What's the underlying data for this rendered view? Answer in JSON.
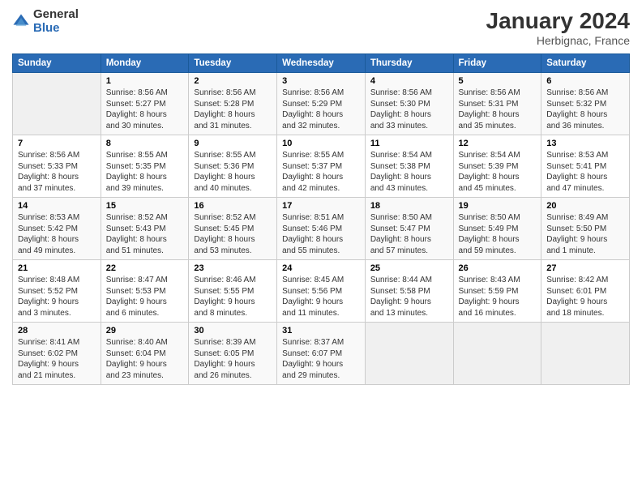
{
  "logo": {
    "general": "General",
    "blue": "Blue"
  },
  "header": {
    "title": "January 2024",
    "subtitle": "Herbignac, France"
  },
  "days_of_week": [
    "Sunday",
    "Monday",
    "Tuesday",
    "Wednesday",
    "Thursday",
    "Friday",
    "Saturday"
  ],
  "weeks": [
    [
      {
        "num": "",
        "info": ""
      },
      {
        "num": "1",
        "info": "Sunrise: 8:56 AM\nSunset: 5:27 PM\nDaylight: 8 hours\nand 30 minutes."
      },
      {
        "num": "2",
        "info": "Sunrise: 8:56 AM\nSunset: 5:28 PM\nDaylight: 8 hours\nand 31 minutes."
      },
      {
        "num": "3",
        "info": "Sunrise: 8:56 AM\nSunset: 5:29 PM\nDaylight: 8 hours\nand 32 minutes."
      },
      {
        "num": "4",
        "info": "Sunrise: 8:56 AM\nSunset: 5:30 PM\nDaylight: 8 hours\nand 33 minutes."
      },
      {
        "num": "5",
        "info": "Sunrise: 8:56 AM\nSunset: 5:31 PM\nDaylight: 8 hours\nand 35 minutes."
      },
      {
        "num": "6",
        "info": "Sunrise: 8:56 AM\nSunset: 5:32 PM\nDaylight: 8 hours\nand 36 minutes."
      }
    ],
    [
      {
        "num": "7",
        "info": "Sunrise: 8:56 AM\nSunset: 5:33 PM\nDaylight: 8 hours\nand 37 minutes."
      },
      {
        "num": "8",
        "info": "Sunrise: 8:55 AM\nSunset: 5:35 PM\nDaylight: 8 hours\nand 39 minutes."
      },
      {
        "num": "9",
        "info": "Sunrise: 8:55 AM\nSunset: 5:36 PM\nDaylight: 8 hours\nand 40 minutes."
      },
      {
        "num": "10",
        "info": "Sunrise: 8:55 AM\nSunset: 5:37 PM\nDaylight: 8 hours\nand 42 minutes."
      },
      {
        "num": "11",
        "info": "Sunrise: 8:54 AM\nSunset: 5:38 PM\nDaylight: 8 hours\nand 43 minutes."
      },
      {
        "num": "12",
        "info": "Sunrise: 8:54 AM\nSunset: 5:39 PM\nDaylight: 8 hours\nand 45 minutes."
      },
      {
        "num": "13",
        "info": "Sunrise: 8:53 AM\nSunset: 5:41 PM\nDaylight: 8 hours\nand 47 minutes."
      }
    ],
    [
      {
        "num": "14",
        "info": "Sunrise: 8:53 AM\nSunset: 5:42 PM\nDaylight: 8 hours\nand 49 minutes."
      },
      {
        "num": "15",
        "info": "Sunrise: 8:52 AM\nSunset: 5:43 PM\nDaylight: 8 hours\nand 51 minutes."
      },
      {
        "num": "16",
        "info": "Sunrise: 8:52 AM\nSunset: 5:45 PM\nDaylight: 8 hours\nand 53 minutes."
      },
      {
        "num": "17",
        "info": "Sunrise: 8:51 AM\nSunset: 5:46 PM\nDaylight: 8 hours\nand 55 minutes."
      },
      {
        "num": "18",
        "info": "Sunrise: 8:50 AM\nSunset: 5:47 PM\nDaylight: 8 hours\nand 57 minutes."
      },
      {
        "num": "19",
        "info": "Sunrise: 8:50 AM\nSunset: 5:49 PM\nDaylight: 8 hours\nand 59 minutes."
      },
      {
        "num": "20",
        "info": "Sunrise: 8:49 AM\nSunset: 5:50 PM\nDaylight: 9 hours\nand 1 minute."
      }
    ],
    [
      {
        "num": "21",
        "info": "Sunrise: 8:48 AM\nSunset: 5:52 PM\nDaylight: 9 hours\nand 3 minutes."
      },
      {
        "num": "22",
        "info": "Sunrise: 8:47 AM\nSunset: 5:53 PM\nDaylight: 9 hours\nand 6 minutes."
      },
      {
        "num": "23",
        "info": "Sunrise: 8:46 AM\nSunset: 5:55 PM\nDaylight: 9 hours\nand 8 minutes."
      },
      {
        "num": "24",
        "info": "Sunrise: 8:45 AM\nSunset: 5:56 PM\nDaylight: 9 hours\nand 11 minutes."
      },
      {
        "num": "25",
        "info": "Sunrise: 8:44 AM\nSunset: 5:58 PM\nDaylight: 9 hours\nand 13 minutes."
      },
      {
        "num": "26",
        "info": "Sunrise: 8:43 AM\nSunset: 5:59 PM\nDaylight: 9 hours\nand 16 minutes."
      },
      {
        "num": "27",
        "info": "Sunrise: 8:42 AM\nSunset: 6:01 PM\nDaylight: 9 hours\nand 18 minutes."
      }
    ],
    [
      {
        "num": "28",
        "info": "Sunrise: 8:41 AM\nSunset: 6:02 PM\nDaylight: 9 hours\nand 21 minutes."
      },
      {
        "num": "29",
        "info": "Sunrise: 8:40 AM\nSunset: 6:04 PM\nDaylight: 9 hours\nand 23 minutes."
      },
      {
        "num": "30",
        "info": "Sunrise: 8:39 AM\nSunset: 6:05 PM\nDaylight: 9 hours\nand 26 minutes."
      },
      {
        "num": "31",
        "info": "Sunrise: 8:37 AM\nSunset: 6:07 PM\nDaylight: 9 hours\nand 29 minutes."
      },
      {
        "num": "",
        "info": ""
      },
      {
        "num": "",
        "info": ""
      },
      {
        "num": "",
        "info": ""
      }
    ]
  ]
}
